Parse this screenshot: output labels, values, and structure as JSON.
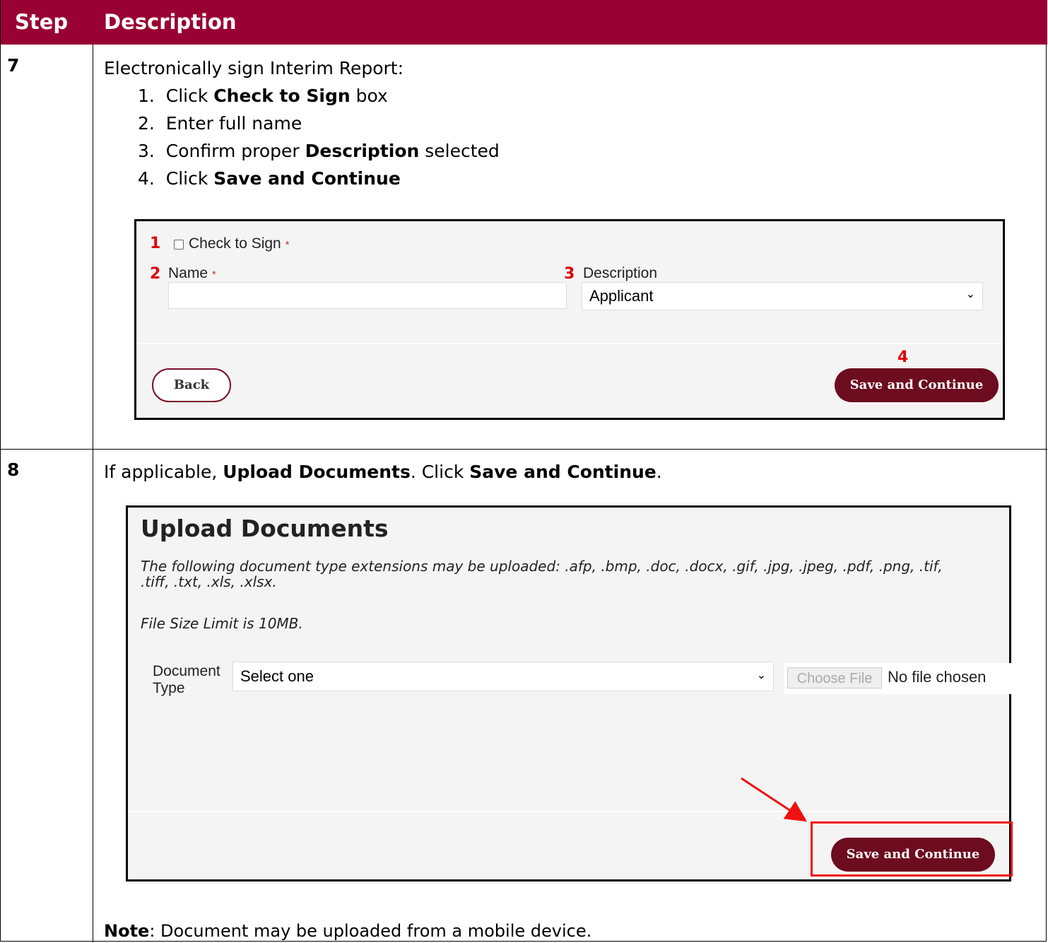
{
  "header": {
    "step_col": "Step",
    "desc_col": "Description"
  },
  "step7": {
    "number": "7",
    "intro": "Electronically sign Interim Report:",
    "items": [
      {
        "num": "1.",
        "pre": "Click ",
        "bold": "Check to Sign",
        "post": " box"
      },
      {
        "num": "2.",
        "pre": "Enter full name",
        "bold": "",
        "post": ""
      },
      {
        "num": "3.",
        "pre": "Confirm proper ",
        "bold": "Description",
        "post": " selected"
      },
      {
        "num": "4.",
        "pre": "Click ",
        "bold": "Save and Continue",
        "post": ""
      }
    ],
    "panel": {
      "marker1": "1",
      "checkbox_label": "Check to Sign",
      "required": "*",
      "marker2": "2",
      "name_label": "Name",
      "marker3": "3",
      "description_label": "Description",
      "description_value": "Applicant",
      "marker4": "4",
      "back_label": "Back",
      "save_label": "Save and Continue"
    }
  },
  "step8": {
    "number": "8",
    "text_pre": "If applicable, ",
    "text_bold1": "Upload Documents",
    "text_mid": ".  Click ",
    "text_bold2": "Save and Continue",
    "text_post": ".",
    "panel": {
      "title": "Upload Documents",
      "extensions": "The following document type extensions may be uploaded: .afp, .bmp, .doc, .docx, .gif, .jpg, .jpeg, .pdf, .png, .tif, .tiff, .txt, .xls, .xlsx.",
      "size_limit": "File Size Limit is 10MB.",
      "doctype_label": "Document Type",
      "doctype_value": "Select one",
      "choose_file": "Choose File",
      "no_file": "No file chosen",
      "save_label": "Save and Continue"
    },
    "note_bold": "Note",
    "note_text": ": Document may be uploaded from a mobile device."
  },
  "colors": {
    "header_bg": "#990033",
    "button_bg": "#6d0c1f",
    "highlight": "#ee1111"
  }
}
